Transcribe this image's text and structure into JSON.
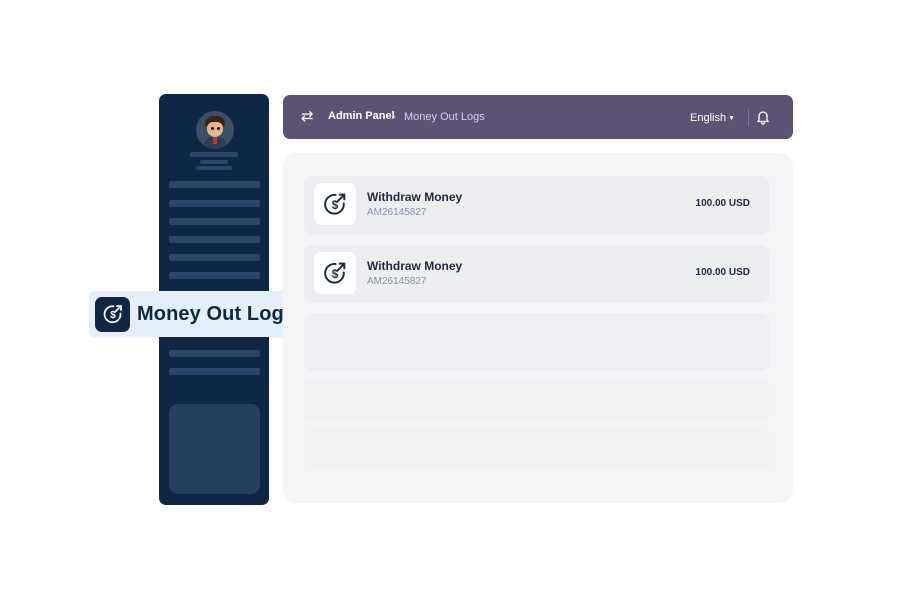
{
  "header": {
    "breadcrumb_root": "Admin Panel",
    "breadcrumb_separator": "›",
    "breadcrumb_current": "Money Out Logs",
    "language": "English",
    "icons": {
      "menu": "swap-arrows-icon",
      "language_caret": "caret-down-icon",
      "notifications": "bell-icon"
    }
  },
  "sidebar": {
    "active_item_label": "Money Out Logs",
    "active_item_icon": "dollar-circle-arrow-icon"
  },
  "transactions": [
    {
      "title": "Withdraw Money",
      "reference": "AM26145827",
      "amount": "100.00 USD",
      "icon": "dollar-circle-arrow-icon"
    },
    {
      "title": "Withdraw Money",
      "reference": "AM26145827",
      "amount": "100.00 USD",
      "icon": "dollar-circle-arrow-icon"
    }
  ],
  "colors": {
    "sidebar": "#0f2744",
    "header": "#5c5273",
    "panel": "#f4f5f7",
    "row": "#eceef1",
    "pill": "#e4effa",
    "text_dark": "#1c2a44",
    "text_muted": "#8a93a3"
  }
}
